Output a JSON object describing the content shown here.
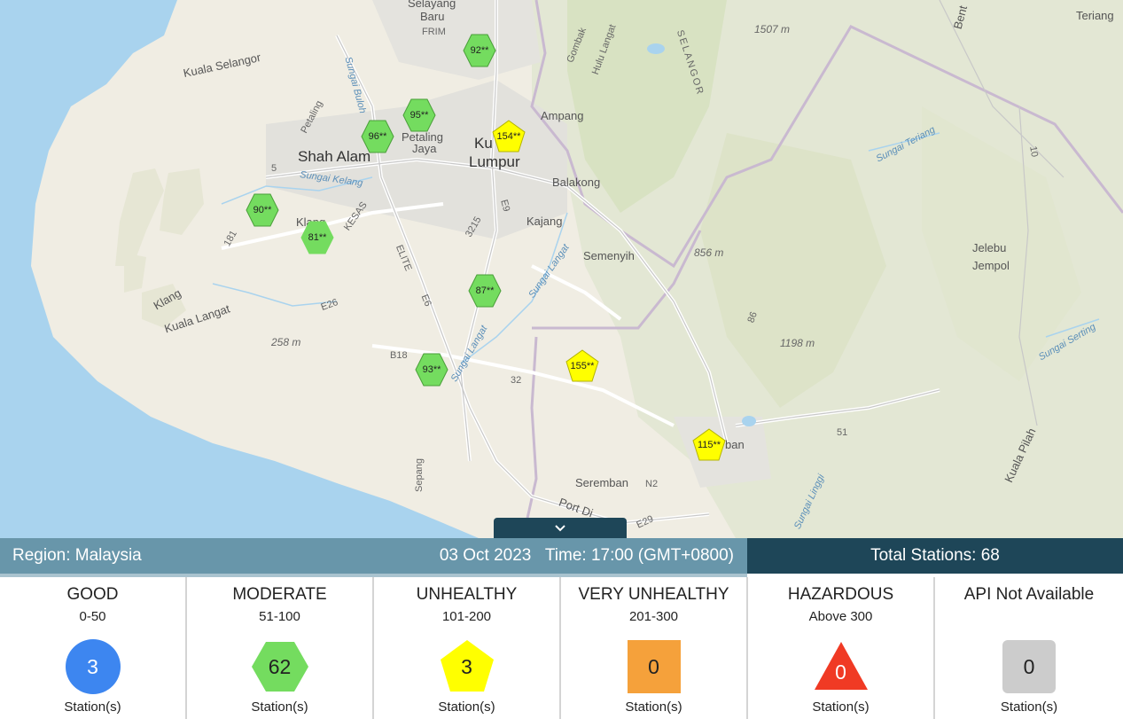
{
  "map": {
    "labels": {
      "selayang": "Selayang",
      "baru": "Baru",
      "frim": "FRIM",
      "kuala_selangor": "Kuala Selangor",
      "petaling_l": "Petaling",
      "shah_alam": "Shah Alam",
      "petaling_jaya1": "Petaling",
      "petaling_jaya2": "Jaya",
      "kuala_lumpur1": "Ku",
      "kuala_lumpur2": "Lumpur",
      "ampang": "Ampang",
      "balakong": "Balakong",
      "kajang": "Kajang",
      "semenyih": "Semenyih",
      "klang": "Klang",
      "kuala_langat": "Kuala Langat",
      "kesas": "KESAS",
      "elite": "ELITE",
      "e6": "E6",
      "e9": "E9",
      "e26": "E26",
      "b18": "B18",
      "r32": "32",
      "r3215": "3215",
      "r5": "5",
      "r181": "181",
      "r10": "10",
      "r86": "86",
      "r51": "51",
      "n2": "N2",
      "e29": "E29",
      "sepang": "Sepang",
      "seremban": "Seremban",
      "seremban_town": "ban",
      "port_dickson": "Port Di",
      "selangor": "SELANGOR",
      "gombak": "Gombak",
      "hulu_langat": "Hulu Langat",
      "jelebu": "Jelebu",
      "jempol": "Jempol",
      "kuala_pilah": "Kuala Pilah",
      "teriang": "Teriang",
      "bentong": "Bent",
      "elev_1507": "1507 m",
      "elev_856": "856 m",
      "elev_1198": "1198 m",
      "elev_258": "258 m",
      "sungai_kelang": "Sungai Kelang",
      "sungai_langat": "Sungai Langat",
      "sungai_langat2": "Sungai Langat",
      "sungai_teriang": "Sungai Teriang",
      "sungai_serting": "Sungai Serting",
      "sungai_linggi": "Sungai Linggi",
      "sungai_buloh": "Sungai Buloh"
    },
    "stations": [
      {
        "value": "92**",
        "level": "moderate"
      },
      {
        "value": "95**",
        "level": "moderate"
      },
      {
        "value": "96**",
        "level": "moderate"
      },
      {
        "value": "154**",
        "level": "unhealthy"
      },
      {
        "value": "90**",
        "level": "moderate"
      },
      {
        "value": "81**",
        "level": "moderate"
      },
      {
        "value": "87**",
        "level": "moderate"
      },
      {
        "value": "93**",
        "level": "moderate"
      },
      {
        "value": "155**",
        "level": "unhealthy"
      },
      {
        "value": "115**",
        "level": "unhealthy"
      }
    ]
  },
  "summary": {
    "region": "Region: Malaysia",
    "datetime": "03 Oct 2023   Time: 17:00 (GMT+0800)",
    "total": "Total Stations: 68"
  },
  "legend": [
    {
      "category": "GOOD",
      "range": "0-50",
      "count": "3",
      "unit": "Station(s)",
      "shape": "circle",
      "color": "#3d86f0"
    },
    {
      "category": "MODERATE",
      "range": "51-100",
      "count": "62",
      "unit": "Station(s)",
      "shape": "hexagon",
      "color": "#74dc5f"
    },
    {
      "category": "UNHEALTHY",
      "range": "101-200",
      "count": "3",
      "unit": "Station(s)",
      "shape": "pentagon",
      "color": "#ffff00"
    },
    {
      "category": "VERY UNHEALTHY",
      "range": "201-300",
      "count": "0",
      "unit": "Station(s)",
      "shape": "square",
      "color": "#f5a13b"
    },
    {
      "category": "HAZARDOUS",
      "range": "Above 300",
      "count": "0",
      "unit": "Station(s)",
      "shape": "triangle",
      "color": "#f03a24"
    },
    {
      "category": "API Not Available",
      "range": "",
      "count": "0",
      "unit": "Station(s)",
      "shape": "rounded-square",
      "color": "#cccccc"
    }
  ],
  "colors": {
    "moderate": "#74dc5f",
    "unhealthy": "#ffff00",
    "sea": "#a9d3ee",
    "bar_left": "#6896aa",
    "bar_right": "#1e4658"
  },
  "icons": {
    "collapse": "chevron-down-icon"
  }
}
